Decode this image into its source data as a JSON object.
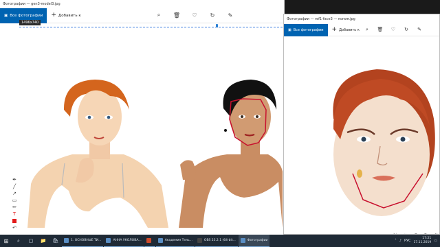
{
  "main_window": {
    "title": "Фотографии — gen3-model3.jpg",
    "tab_all_photos": "Все фотографии",
    "add_to": "Добавить к",
    "size_tooltip": "1496x740"
  },
  "side_window": {
    "title": "Фотографии — ref1-face3 — копия.jpg",
    "tab_all_photos": "Все фотографии",
    "add_to": "Добавить к"
  },
  "toolbar_icons": [
    "zoom-icon",
    "delete-icon",
    "favorite-icon",
    "rotate-icon",
    "edit-icon"
  ],
  "drawing_tools": [
    "pen-icon",
    "line-icon",
    "arrow-icon",
    "rect-icon",
    "marker-icon",
    "text-icon",
    "color-red",
    "undo-icon"
  ],
  "colors": {
    "accent": "#0063b1",
    "face_outline": "#c8102e",
    "taskbar": "#1f2a36"
  },
  "taskbar": {
    "apps": [
      "1. ОСНОВНЫЕ ТИ...",
      "АННА УКОЛОВА...",
      "",
      "Академия Тель...",
      "OBS 23.2.1 (64-bit...",
      "Фотографии"
    ],
    "language": "РУС",
    "time": "17:21",
    "date": "17.11.2019"
  }
}
